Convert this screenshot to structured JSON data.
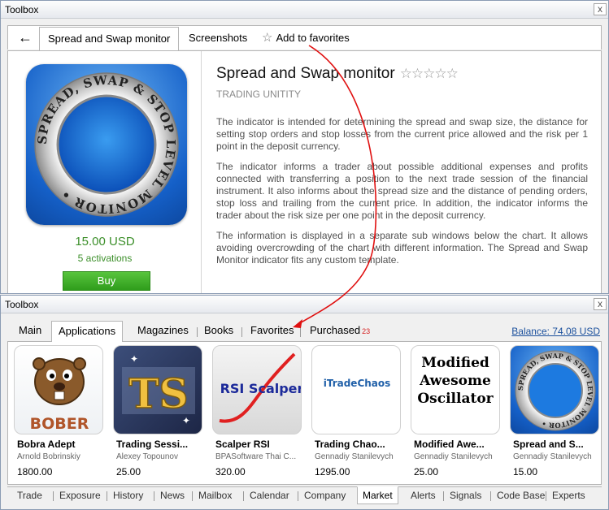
{
  "top_window": {
    "title": "Toolbox",
    "close": "x",
    "tabs": [
      "Spread and Swap monitor",
      "Screenshots",
      "Add to favorites"
    ],
    "product": {
      "icon_text": "SPREAD, SWAP & STOP LEVEL MONITOR •",
      "price": "15.00 USD",
      "activations": "5 activations",
      "buy": "Buy",
      "title": "Spread and Swap monitor",
      "stars": "☆☆☆☆☆",
      "vendor": "TRADING UNITITY",
      "description": [
        "The indicator is intended for determining the spread and swap size, the distance for setting stop orders and stop losses from the current price allowed and the risk per 1 point in the deposit currency.",
        "The indicator informs a trader about possible additional expenses and profits connected with transferring a position to the next trade session of the financial instrument. It also informs about the spread size and the distance of pending orders, stop loss and trailing from the current price. In addition, the indicator informs the trader about the risk size per one point in the deposit currency.",
        "The information is displayed in a separate sub windows below the chart. It allows avoiding overcrowding of the chart with different information. The Spread and Swap Monitor indicator fits any custom template."
      ]
    }
  },
  "bottom_window": {
    "title": "Toolbox",
    "close": "x",
    "tabs": [
      "Main",
      "Applications",
      "Magazines",
      "Books",
      "Favorites",
      "Purchased"
    ],
    "purchased_badge": "23",
    "balance": "Balance: 74.08 USD",
    "apps": [
      {
        "name": "Bobra Adept",
        "author": "Arnold Bobrinskiy",
        "price": "1800.00",
        "img_text": "BOBER"
      },
      {
        "name": "Trading Sessi...",
        "author": "Alexey Topounov",
        "price": "25.00",
        "img_text": "TS"
      },
      {
        "name": "Scalper RSI",
        "author": "BPASoftware Thai C...",
        "price": "320.00",
        "img_text": "RSI Scalper"
      },
      {
        "name": "Trading Chao...",
        "author": "Gennadiy Stanilevych",
        "price": "1295.00",
        "img_text": "iTradeChaos"
      },
      {
        "name": "Modified Awe...",
        "author": "Gennadiy Stanilevych",
        "price": "25.00",
        "img_text": "Modified Awesome Oscillator"
      },
      {
        "name": "Spread and S...",
        "author": "Gennadiy Stanilevych",
        "price": "15.00",
        "img_text": "SPREAD, SWAP & STOP LEVEL MONITOR •"
      }
    ],
    "bottom_tabs": [
      "Trade",
      "Exposure",
      "History",
      "News",
      "Mailbox",
      "Calendar",
      "Company",
      "Market",
      "Alerts",
      "Signals",
      "Code Base",
      "Experts"
    ]
  },
  "colors": {
    "accent_green": "#3c8f2a",
    "buy_green": "#2f9d1c",
    "badge_red": "#d62222",
    "link_blue": "#1a4f9c",
    "arrow_red": "#e01010"
  }
}
